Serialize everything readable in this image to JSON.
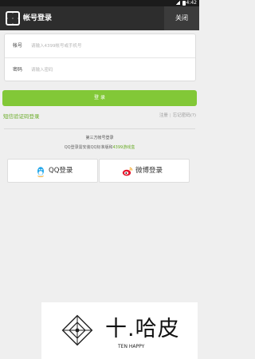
{
  "status_bar": {
    "time": "4:42"
  },
  "app_bar": {
    "title": "帐号登录",
    "close_label": "关闭"
  },
  "form": {
    "account": {
      "label": "帐号",
      "placeholder": "请输入4399帐号或手机号"
    },
    "password": {
      "label": "密码",
      "placeholder": "请输入密码"
    }
  },
  "login_button": "登 录",
  "links": {
    "sms_login": "短信验证码登录",
    "register": "注册",
    "separator": "|",
    "forgot": "忘记密码(?)"
  },
  "third_party": {
    "title": "第三方帐号登录",
    "note_prefix": "QQ登录需安装QQ标准版和",
    "note_highlight": "4399游戏盒",
    "qq_label": "QQ登录",
    "weibo_label": "微博登录"
  },
  "watermark": {
    "cn": "十.哈皮",
    "en": "TEN HAPPY"
  },
  "colors": {
    "accent": "#82c837",
    "link": "#6aac28",
    "appbar": "#2d2d2d",
    "qq": "#1ea5e9",
    "weibo": "#e6162d"
  },
  "icons": [
    "app-logo-icon",
    "qq-penguin-icon",
    "weibo-icon",
    "ten-happy-logo-icon"
  ]
}
